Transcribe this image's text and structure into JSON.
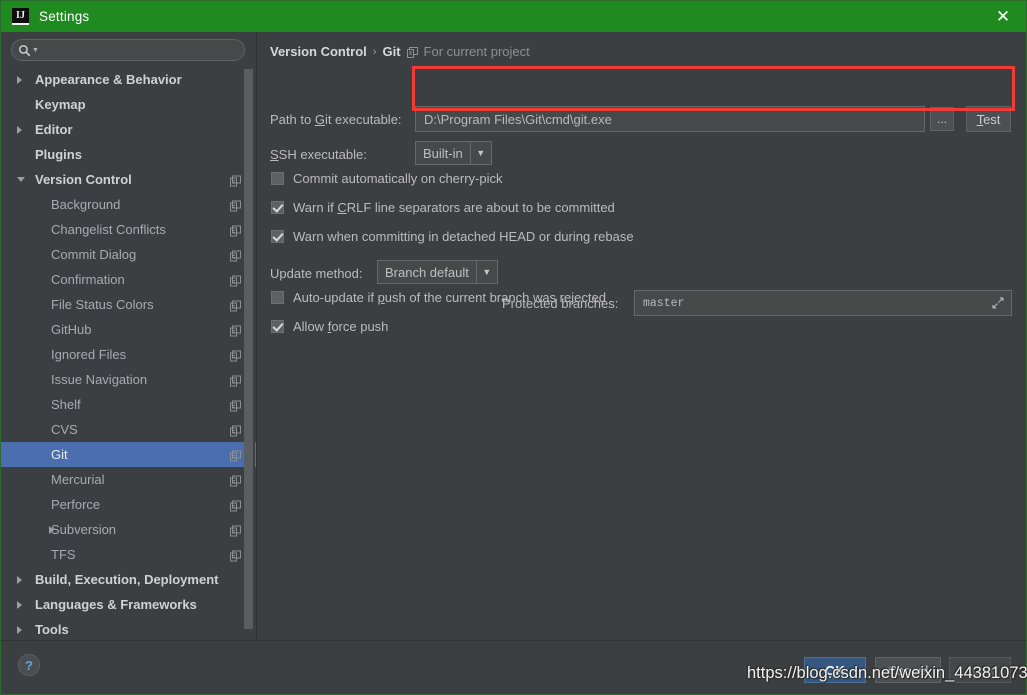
{
  "window": {
    "title": "Settings",
    "logo_icon": "intellij-idea-logo-icon",
    "close_icon": "close-icon",
    "accent_green": "#1f8a1f",
    "background": "#3c3f41"
  },
  "search": {
    "value": "",
    "placeholder": "",
    "icon": "search-icon",
    "caret_icon": "chevron-down-icon"
  },
  "sidebar": {
    "items": [
      {
        "label": "Appearance & Behavior",
        "level": 0,
        "arrow": "right",
        "bold": true,
        "project_icon": false,
        "selected": false
      },
      {
        "label": "Keymap",
        "level": 0,
        "arrow": "none",
        "bold": true,
        "project_icon": false,
        "selected": false
      },
      {
        "label": "Editor",
        "level": 0,
        "arrow": "right",
        "bold": true,
        "project_icon": false,
        "selected": false
      },
      {
        "label": "Plugins",
        "level": 0,
        "arrow": "none",
        "bold": true,
        "project_icon": false,
        "selected": false
      },
      {
        "label": "Version Control",
        "level": 0,
        "arrow": "down",
        "bold": true,
        "project_icon": true,
        "selected": false
      },
      {
        "label": "Background",
        "level": 1,
        "arrow": "none",
        "bold": false,
        "project_icon": true,
        "selected": false
      },
      {
        "label": "Changelist Conflicts",
        "level": 1,
        "arrow": "none",
        "bold": false,
        "project_icon": true,
        "selected": false
      },
      {
        "label": "Commit Dialog",
        "level": 1,
        "arrow": "none",
        "bold": false,
        "project_icon": true,
        "selected": false
      },
      {
        "label": "Confirmation",
        "level": 1,
        "arrow": "none",
        "bold": false,
        "project_icon": true,
        "selected": false
      },
      {
        "label": "File Status Colors",
        "level": 1,
        "arrow": "none",
        "bold": false,
        "project_icon": true,
        "selected": false
      },
      {
        "label": "GitHub",
        "level": 1,
        "arrow": "none",
        "bold": false,
        "project_icon": true,
        "selected": false
      },
      {
        "label": "Ignored Files",
        "level": 1,
        "arrow": "none",
        "bold": false,
        "project_icon": true,
        "selected": false
      },
      {
        "label": "Issue Navigation",
        "level": 1,
        "arrow": "none",
        "bold": false,
        "project_icon": true,
        "selected": false
      },
      {
        "label": "Shelf",
        "level": 1,
        "arrow": "none",
        "bold": false,
        "project_icon": true,
        "selected": false
      },
      {
        "label": "CVS",
        "level": 1,
        "arrow": "none",
        "bold": false,
        "project_icon": true,
        "selected": false
      },
      {
        "label": "Git",
        "level": 1,
        "arrow": "none",
        "bold": false,
        "project_icon": true,
        "selected": true
      },
      {
        "label": "Mercurial",
        "level": 1,
        "arrow": "none",
        "bold": false,
        "project_icon": true,
        "selected": false
      },
      {
        "label": "Perforce",
        "level": 1,
        "arrow": "none",
        "bold": false,
        "project_icon": true,
        "selected": false
      },
      {
        "label": "Subversion",
        "level": 1,
        "arrow": "right",
        "bold": false,
        "project_icon": true,
        "selected": false
      },
      {
        "label": "TFS",
        "level": 1,
        "arrow": "none",
        "bold": false,
        "project_icon": true,
        "selected": false
      },
      {
        "label": "Build, Execution, Deployment",
        "level": 0,
        "arrow": "right",
        "bold": true,
        "project_icon": false,
        "selected": false
      },
      {
        "label": "Languages & Frameworks",
        "level": 0,
        "arrow": "right",
        "bold": true,
        "project_icon": false,
        "selected": false
      },
      {
        "label": "Tools",
        "level": 0,
        "arrow": "right",
        "bold": true,
        "project_icon": false,
        "selected": false
      }
    ],
    "selection_color": "#4b6eaf"
  },
  "main": {
    "breadcrumb": {
      "root": "Version Control",
      "separator": "›",
      "current": "Git",
      "scope_note": "For current project",
      "scope_icon": "project-scope-icon"
    },
    "git_path": {
      "label_pre": "Path to ",
      "label_mnemonic": "G",
      "label_post": "it executable:",
      "value": "D:\\Program Files\\Git\\cmd\\git.exe",
      "browse_label": "...",
      "test_label_mnemonic": "T",
      "test_label_post": "est"
    },
    "ssh": {
      "label_mnemonic": "S",
      "label_post": "SH executable:",
      "value": "Built-in",
      "arrow_icon": "chevron-down-icon"
    },
    "checkboxes": [
      {
        "pre": "Commit automatically on cherry-pick",
        "mnemonic": "",
        "post": "",
        "checked": false
      },
      {
        "pre": "Warn if ",
        "mnemonic": "C",
        "post": "RLF line separators are about to be committed",
        "checked": true
      },
      {
        "pre": "Warn when committing in detached HEAD or during rebase",
        "mnemonic": "",
        "post": "",
        "checked": true
      },
      {
        "pre": "Auto-update if ",
        "mnemonic": "p",
        "post": "ush of the current branch was rejected",
        "checked": false
      },
      {
        "pre": "Allow ",
        "mnemonic": "f",
        "post": "orce push",
        "checked": true
      }
    ],
    "update_method": {
      "label": "Update method:",
      "value": "Branch default",
      "arrow_icon": "chevron-down-icon"
    },
    "protected_branches": {
      "label": "Protected branches:",
      "value": "master",
      "expand_icon": "expand-icon"
    }
  },
  "footer": {
    "help_label": "?",
    "help_icon": "help-icon",
    "ok_label": "OK",
    "cancel_label": "Cancel",
    "apply_label": "Apply"
  },
  "overlay": {
    "watermark": "https://blog.csdn.net/weixin_44381073",
    "annotation_color": "#f03c34"
  }
}
